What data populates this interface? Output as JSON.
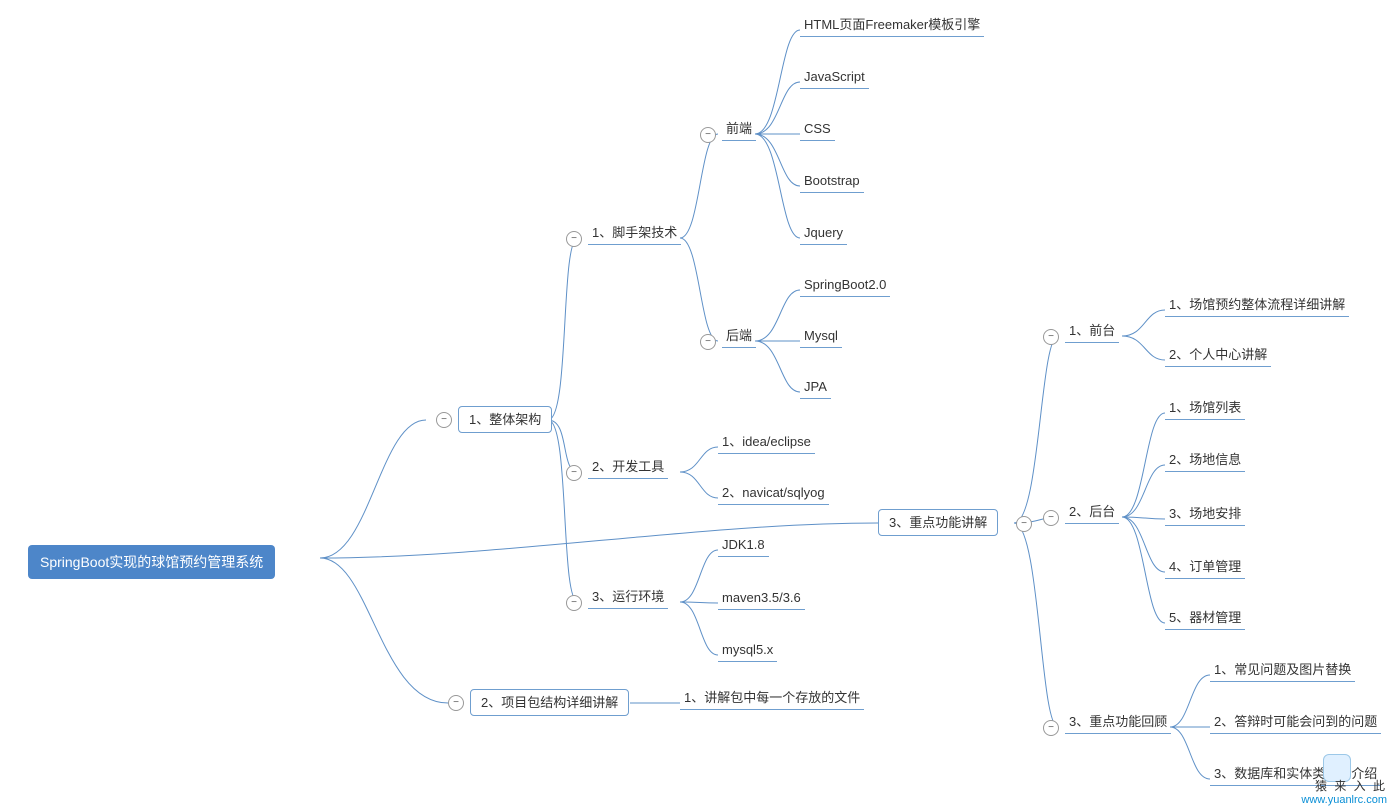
{
  "colors": {
    "rootBg": "#4d86c9",
    "nodeBorder": "#6f9ecf",
    "connector": "#5e90c7",
    "text": "#333333"
  },
  "watermark": {
    "line1": "猿 来 入 此",
    "line2": "www.yuanlrc.com"
  },
  "root": {
    "label": "SpringBoot实现的球馆预约管理系统"
  },
  "branches": {
    "b1": "1、整体架构",
    "b2": "2、项目包结构详细讲解",
    "b3": "3、重点功能讲解"
  },
  "arch": {
    "scaffold": "1、脚手架技术",
    "devtools": "2、开发工具",
    "runtime": "3、运行环境",
    "frontend": "前端",
    "backend": "后端"
  },
  "frontend_items": {
    "i1": "HTML页面Freemaker模板引擎",
    "i2": "JavaScript",
    "i3": "CSS",
    "i4": "Bootstrap",
    "i5": "Jquery"
  },
  "backend_items": {
    "i1": "SpringBoot2.0",
    "i2": "Mysql",
    "i3": "JPA"
  },
  "devtools_items": {
    "i1": "1、idea/eclipse",
    "i2": "2、navicat/sqlyog"
  },
  "runtime_items": {
    "i1": "JDK1.8",
    "i2": "maven3.5/3.6",
    "i3": "mysql5.x"
  },
  "pkg_items": {
    "i1": "1、讲解包中每一个存放的文件"
  },
  "features": {
    "front": "1、前台",
    "back": "2、后台",
    "review": "3、重点功能回顾"
  },
  "feat_front": {
    "i1": "1、场馆预约整体流程详细讲解",
    "i2": "2、个人中心讲解"
  },
  "feat_back": {
    "i1": "1、场馆列表",
    "i2": "2、场地信息",
    "i3": "3、场地安排",
    "i4": "4、订单管理",
    "i5": "5、器材管理"
  },
  "feat_review": {
    "i1": "1、常见问题及图片替换",
    "i2": "2、答辩时可能会问到的问题",
    "i3": "3、数据库和实体类详细介绍"
  }
}
